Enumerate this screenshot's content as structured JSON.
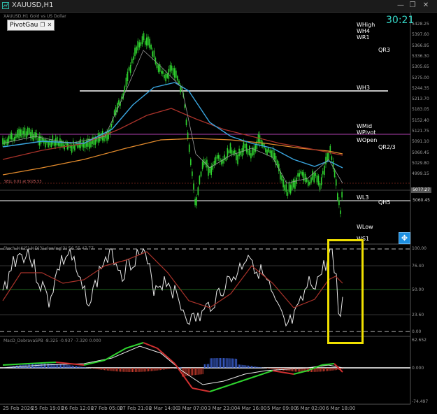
{
  "window": {
    "title": "XAUUSD,H1",
    "icon": "window-icon",
    "controls": [
      "—",
      "❐",
      "✕"
    ]
  },
  "chart": {
    "indicator_label": "PivotGau",
    "symbol_header": "XAUUSD,H1 Gold vs US Dollar",
    "countdown": "30:21",
    "sell_label": "SELL 0.01 at 5025.53",
    "pivot_labels": {
      "whigh": "WHigh",
      "wh4": "WH4",
      "wr1": "WR1",
      "qr3": "QR3",
      "wh3": "WH3",
      "wmid": "WMid",
      "wpivot": "WPivot",
      "wopen": "WOpen",
      "qr23": "QR2/3",
      "wl3": "WL3",
      "qh5": "QH5",
      "wlow": "WLow",
      "ws1": "WS1"
    },
    "price_axis": [
      "5428.25",
      "5397.60",
      "5366.95",
      "5336.30",
      "5305.65",
      "5275.00",
      "5244.35",
      "5213.70",
      "5183.05",
      "5152.40",
      "5121.75",
      "5091.10",
      "5060.45",
      "5029.80",
      "4999.15"
    ],
    "current_price": "5077.27",
    "price_tag_2": "5060.45",
    "stoch_header": "Stoch  %K(5) %D(3) slowing(3)  56.55  47.77",
    "stoch_axis": [
      "100.00",
      "76.40",
      "50.00",
      "23.60",
      "0.00"
    ],
    "macd_header": "MacD_DobravaSPB -8.325  -0.937  -7.320  0.000",
    "macd_axis": [
      "62.652",
      "0.000",
      "-74.497"
    ],
    "dates": [
      "25 Feb 2026",
      "25 Feb 19:00",
      "26 Feb 12:00",
      "27 Feb 05:00",
      "27 Feb 21:00",
      "2 Mar 14:00",
      "3 Mar 07:00",
      "3 Mar 23:00",
      "4 Mar 16:00",
      "5 Mar 09:00",
      "6 Mar 02:00",
      "6 Mar 18:00"
    ],
    "colors": {
      "candle": "#2fd42f",
      "ma_fast": "#bbbbbb",
      "ma_blue": "#3aa6e0",
      "ma_red": "#c0392b",
      "ma_orange": "#e28a2c",
      "pivot_white": "#ffffff",
      "pivot_purple": "#b040b0",
      "highlight": "#f0e000",
      "countdown": "#35d6c6"
    }
  }
}
